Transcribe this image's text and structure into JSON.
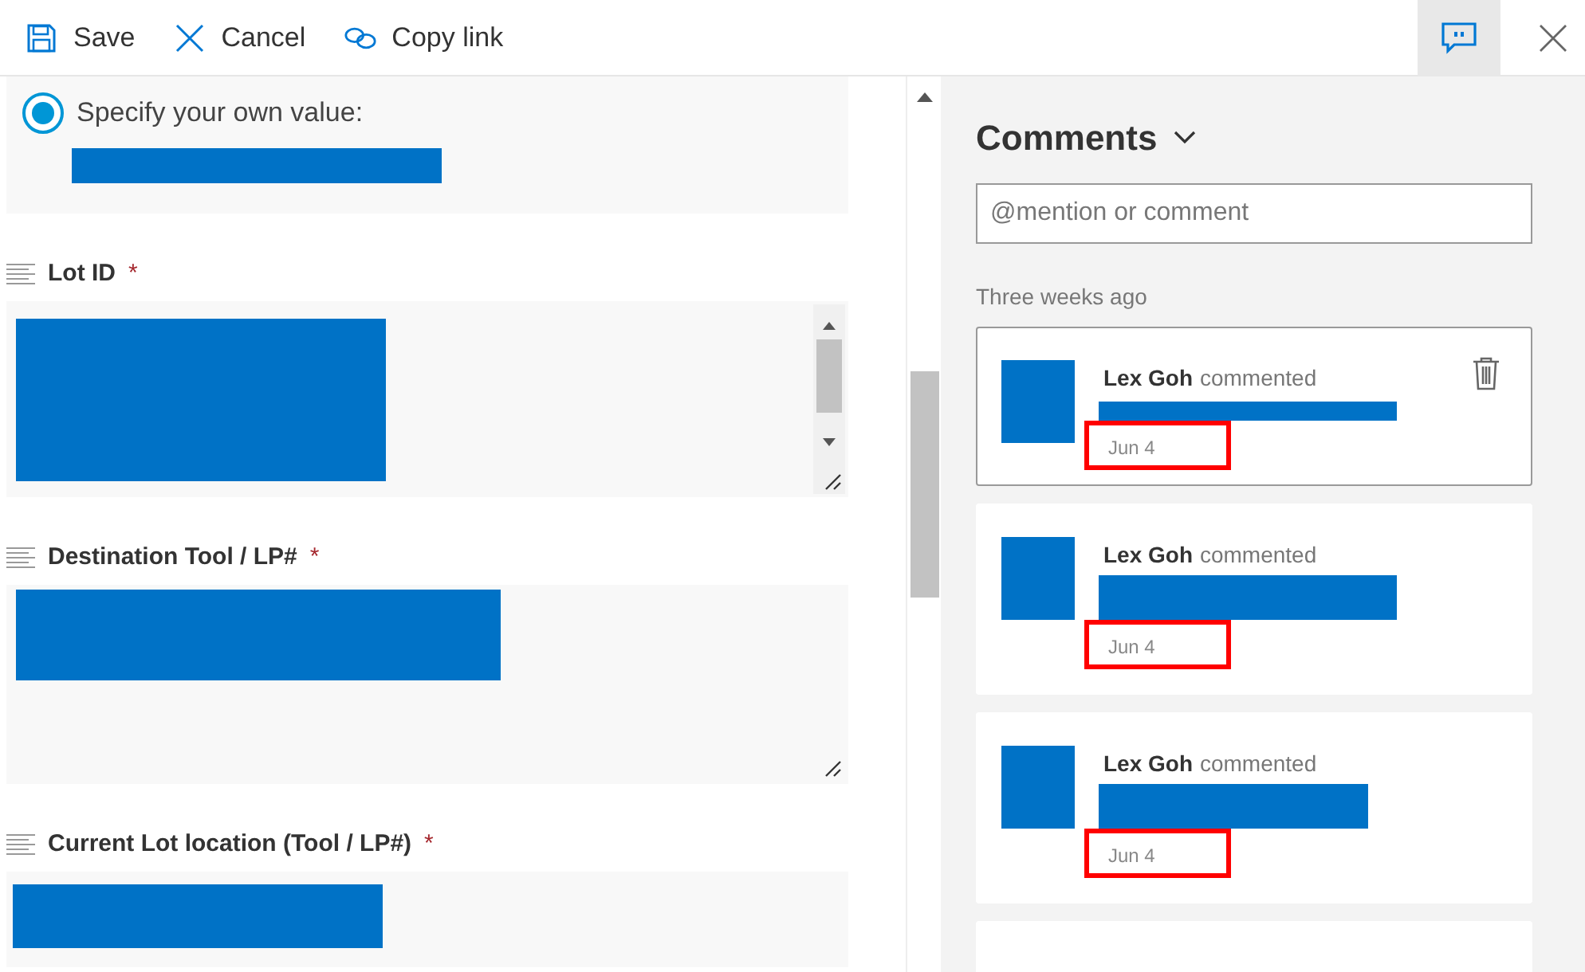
{
  "toolbar": {
    "buttons": [
      {
        "kind": "save",
        "label": "Save"
      },
      {
        "kind": "cancel",
        "label": "Cancel"
      },
      {
        "kind": "link",
        "label": "Copy link"
      }
    ],
    "comments_toggle": {
      "selected": true
    }
  },
  "choice": {
    "label": "Specify your own value:",
    "selected": true,
    "redacted": true
  },
  "fields": [
    {
      "label": "Lot ID",
      "required_mark": "*",
      "redacted": true,
      "scrollbar": true
    },
    {
      "label": "Destination Tool / LP#",
      "required_mark": "*",
      "redacted": true,
      "scrollbar": false
    },
    {
      "label": "Current Lot location (Tool / LP#)",
      "required_mark": "*",
      "redacted": true,
      "scrollbar": false
    }
  ],
  "comments_panel": {
    "title": "Comments",
    "placeholder": "@mention or comment",
    "group_label": "Three weeks ago",
    "comments": [
      {
        "author": "Lex Goh",
        "action": "commented",
        "date": "Jun 4",
        "selected": true,
        "highlighted": true
      },
      {
        "author": "Lex Goh",
        "action": "commented",
        "date": "Jun 4",
        "selected": false,
        "highlighted": true
      },
      {
        "author": "Lex Goh",
        "action": "commented",
        "date": "Jun 4",
        "selected": false,
        "highlighted": true
      }
    ]
  }
}
